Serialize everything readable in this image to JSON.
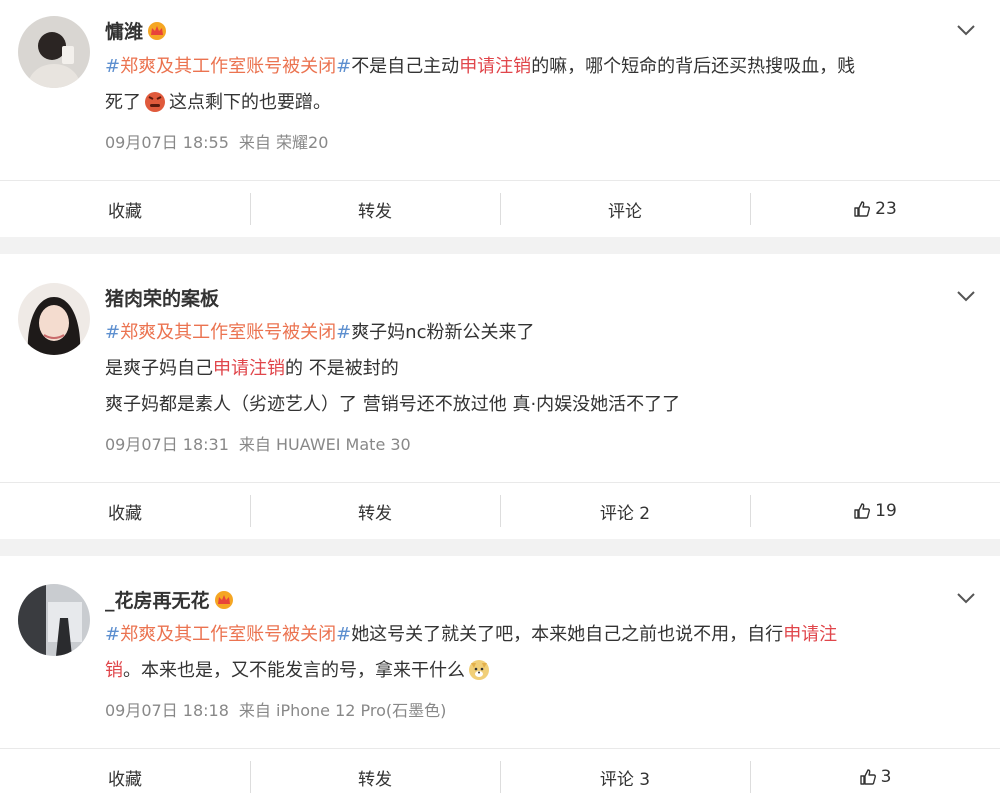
{
  "colors": {
    "hashtag": "#5d8fcf",
    "keyword": "#e0464b",
    "meta": "#888888"
  },
  "posts": [
    {
      "user": "慵潍",
      "hashtag": "郑爽及其工作室账号被关闭",
      "line1_a": "不是自己主动",
      "line1_kw": "申请注销",
      "line1_b": "的嘛，哪个短命的背后还买热搜吸血，贱",
      "line2_a": "死了",
      "line2_emoji": "angry-face-icon",
      "line2_b": "这点剩下的也要蹭。",
      "time": "09月07日 18:55",
      "source": "来自 荣耀20",
      "actions": {
        "fav": "收藏",
        "repost": "转发",
        "comment": "评论",
        "like": "23"
      }
    },
    {
      "user": "猪肉荣的案板",
      "hashtag": "郑爽及其工作室账号被关闭",
      "line1_b": "爽子妈nc粉新公关来了",
      "line2_a": "是爽子妈自己",
      "line2_kw": "申请注销",
      "line2_b": "的 不是被封的",
      "line3": "爽子妈都是素人（劣迹艺人）了 营销号还不放过他 真·内娱没她活不了了",
      "time": "09月07日 18:31",
      "source": "来自 HUAWEI Mate 30",
      "actions": {
        "fav": "收藏",
        "repost": "转发",
        "comment": "评论 2",
        "like": "19"
      }
    },
    {
      "user": "_花房再无花",
      "hashtag": "郑爽及其工作室账号被关闭",
      "line1_b": "她这号关了就关了吧，本来她自己之前也说不用，自行",
      "line1_kw": "申请注",
      "line2_kw": "销",
      "line2_b": "。本来也是，又不能发言的号，拿来干什么",
      "line2_emoji": "doge-icon",
      "time": "09月07日 18:18",
      "source": "来自 iPhone 12 Pro(石墨色)",
      "actions": {
        "fav": "收藏",
        "repost": "转发",
        "comment": "评论 3",
        "like": "3"
      }
    }
  ]
}
